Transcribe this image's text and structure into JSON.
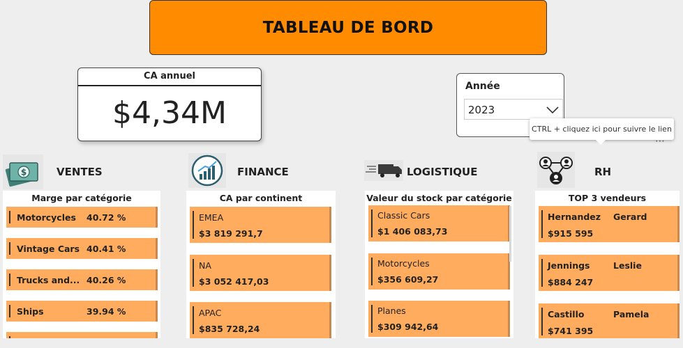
{
  "header": {
    "title": "TABLEAU DE BORD"
  },
  "kpi": {
    "label": "CA annuel",
    "value": "$4,34M"
  },
  "slicer": {
    "title": "Année",
    "selected": "2023"
  },
  "tooltip": {
    "text": "CTRL + cliquez ici pour suivre le lien"
  },
  "sections": {
    "ventes": {
      "title": "VENTES",
      "panel_title": "Marge par catégorie",
      "items": [
        {
          "name": "Motorcycles",
          "value": "40.72 %"
        },
        {
          "name": "Vintage Cars",
          "value": "40.41 %"
        },
        {
          "name": "Trucks and...",
          "value": "40.26 %"
        },
        {
          "name": "Ships",
          "value": "39.94 %"
        }
      ]
    },
    "finance": {
      "title": "FINANCE",
      "panel_title": "CA par continent",
      "items": [
        {
          "name": "EMEA",
          "value": "$3 819 291,7"
        },
        {
          "name": "NA",
          "value": "$3 052 417,03"
        },
        {
          "name": "APAC",
          "value": "$835 728,24"
        }
      ]
    },
    "logistique": {
      "title": "LOGISTIQUE",
      "panel_title": "Valeur du stock par catégorie",
      "items": [
        {
          "name": "Classic Cars",
          "value": "$1 406 083,73"
        },
        {
          "name": "Motorcycles",
          "value": "$356 609,27"
        },
        {
          "name": "Planes",
          "value": "$309 942,64"
        }
      ]
    },
    "rh": {
      "title": "RH",
      "panel_title": "TOP 3 vendeurs",
      "items": [
        {
          "last": "Hernandez",
          "first": "Gerard",
          "value": "$915 595"
        },
        {
          "last": "Jennings",
          "first": "Leslie",
          "value": "$884 247"
        },
        {
          "last": "Castillo",
          "first": "Pamela",
          "value": "$741 395"
        }
      ]
    }
  },
  "colors": {
    "accent": "#ff8c00",
    "card": "#ffac5f",
    "background": "#eeeeee"
  }
}
